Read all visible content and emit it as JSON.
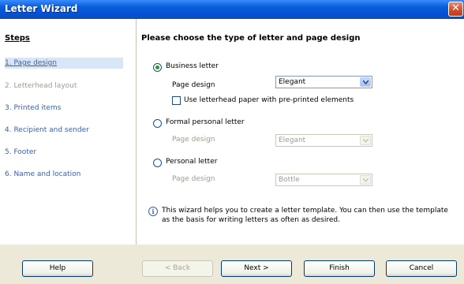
{
  "window": {
    "title": "Letter Wizard",
    "close_glyph": "✕"
  },
  "sidebar": {
    "title": "Steps",
    "items": [
      {
        "label": "1. Page design"
      },
      {
        "label": "2. Letterhead layout"
      },
      {
        "label": "3. Printed items"
      },
      {
        "label": "4. Recipient and sender"
      },
      {
        "label": "5. Footer"
      },
      {
        "label": "6. Name and location"
      }
    ]
  },
  "main": {
    "heading": "Please choose the  type of letter and page design",
    "business": {
      "label": "Business letter",
      "page_design_label": "Page design",
      "page_design_value": "Elegant",
      "letterhead_label": "Use letterhead paper with pre-printed elements"
    },
    "formal": {
      "label": "Formal personal letter",
      "page_design_label": "Page design",
      "page_design_value": "Elegant"
    },
    "personal": {
      "label": "Personal letter",
      "page_design_label": "Page design",
      "page_design_value": "Bottle"
    },
    "info": "This wizard helps you to create a letter template. You can then use the template as the basis for writing letters as often as desired."
  },
  "buttons": {
    "help": "Help",
    "back": "< Back",
    "next": "Next >",
    "finish": "Finish",
    "cancel": "Cancel"
  }
}
